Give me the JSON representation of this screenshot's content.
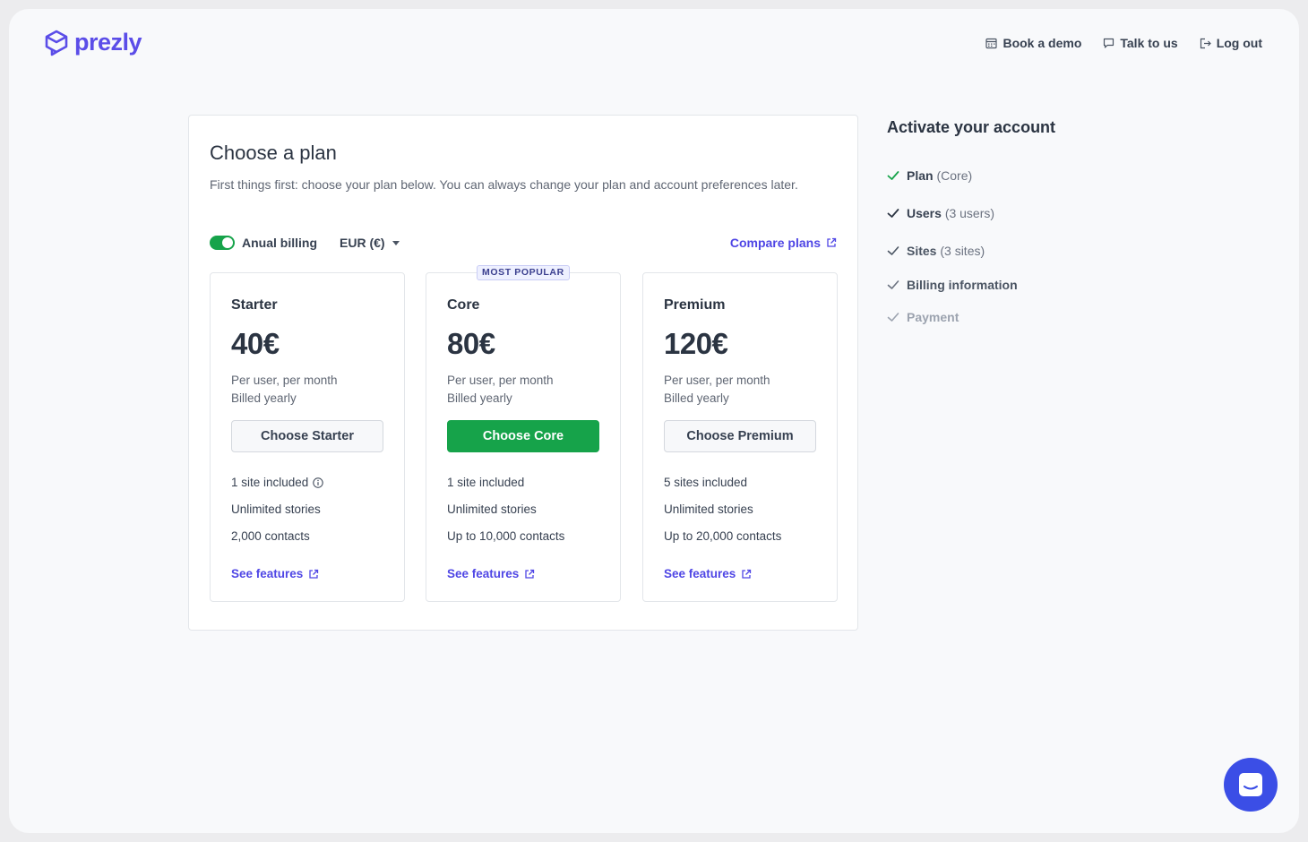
{
  "brand": {
    "name": "prezly",
    "color": "#5b4de8"
  },
  "topnav": {
    "book_demo": "Book a demo",
    "talk": "Talk to us",
    "logout": "Log out"
  },
  "main": {
    "title": "Choose a plan",
    "intro": "First things first: choose your plan below. You can always change your plan and account preferences later.",
    "billing_label": "Anual billing",
    "billing_on": true,
    "currency": "EUR (€)",
    "compare": "Compare plans"
  },
  "plans": [
    {
      "name": "Starter",
      "price": "40€",
      "per": "Per user, per month",
      "billed": "Billed yearly",
      "button": "Choose Starter",
      "features": [
        "1 site included",
        "Unlimited stories",
        "2,000 contacts"
      ],
      "see": "See features"
    },
    {
      "name": "Core",
      "badge": "MOST POPULAR",
      "price": "80€",
      "per": "Per user, per month",
      "billed": "Billed yearly",
      "button": "Choose Core",
      "features": [
        "1 site included",
        "Unlimited stories",
        "Up to 10,000 contacts"
      ],
      "see": "See features"
    },
    {
      "name": "Premium",
      "price": "120€",
      "per": "Per user, per month",
      "billed": "Billed yearly",
      "button": "Choose Premium",
      "features": [
        "5 sites included",
        "Unlimited stories",
        "Up to 20,000 contacts"
      ],
      "see": "See features"
    }
  ],
  "side": {
    "title": "Activate your account",
    "steps": [
      {
        "label": "Plan",
        "sub": "(Core)"
      },
      {
        "label": "Users",
        "sub": "(3 users)"
      },
      {
        "label": "Sites",
        "sub": "(3 sites)"
      },
      {
        "label": "Billing information",
        "sub": ""
      },
      {
        "label": "Payment",
        "sub": ""
      }
    ]
  },
  "colors": {
    "accent": "#4f46e5",
    "green": "#16a34a",
    "chat": "#3b4ee6"
  },
  "icons": [
    "prezly-logo-icon",
    "calendar-icon",
    "chat-bubble-icon",
    "logout-icon",
    "external-link-icon",
    "info-icon",
    "check-icon",
    "messenger-icon"
  ]
}
